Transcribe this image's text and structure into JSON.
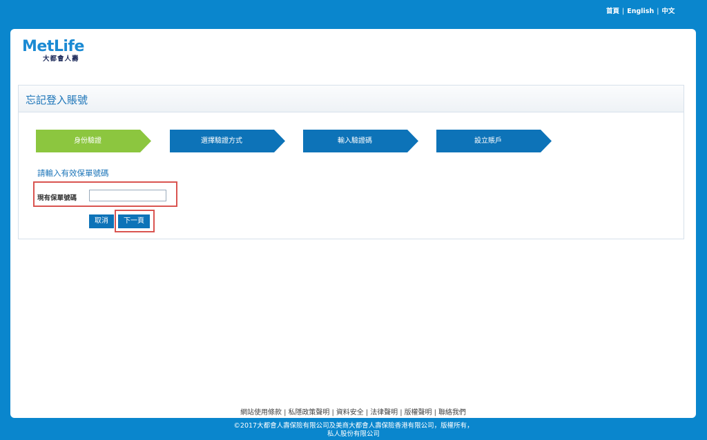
{
  "top_nav": {
    "home": "首頁",
    "sep": "|",
    "english": "English",
    "chinese": "中文"
  },
  "logo": {
    "brand": "MetLife",
    "chinese_name": "大都會人壽"
  },
  "panel": {
    "title": "忘記登入賬號"
  },
  "steps": [
    {
      "label": "身份驗證",
      "active": true
    },
    {
      "label": "選擇驗證方式",
      "active": false
    },
    {
      "label": "輸入驗證碼",
      "active": false
    },
    {
      "label": "設立賬戶",
      "active": false
    }
  ],
  "form": {
    "prompt": "請輸入有效保單號碼",
    "policy_label": "現有保單號碼",
    "policy_value": "",
    "cancel": "取消",
    "next": "下一頁"
  },
  "footer": {
    "links": [
      "網站使用條款",
      "私隱政策聲明",
      "資料安全",
      "法律聲明",
      "版權聲明",
      "聯絡我們"
    ],
    "sep": "|",
    "copyright_line1": "©2017大都會人壽保險有限公司及美商大都會人壽保險香港有限公司，版權所有，",
    "copyright_line2": "私人股份有限公司"
  },
  "colors": {
    "brand_blue": "#0a86cd",
    "step_active": "#8cc63f",
    "step_inactive": "#0d73b8",
    "highlight": "#d9534f"
  }
}
